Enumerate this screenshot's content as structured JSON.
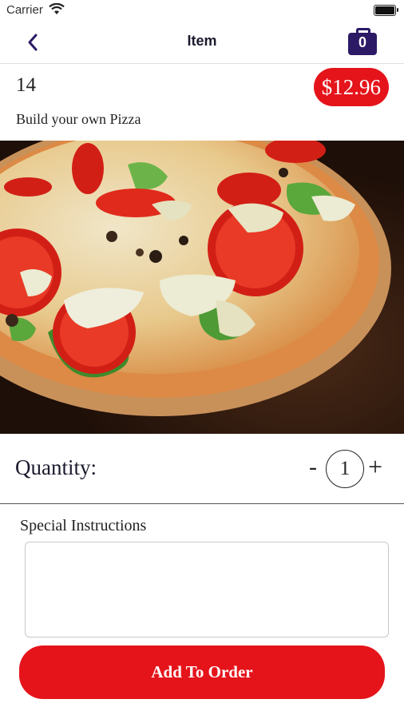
{
  "status_bar": {
    "carrier": "Carrier"
  },
  "nav": {
    "title": "Item",
    "cart_count": "0"
  },
  "item": {
    "number": "14",
    "price": "$12.96",
    "name": "Build your own Pizza"
  },
  "quantity": {
    "label": "Quantity:",
    "minus": "-",
    "value": "1",
    "plus": "+"
  },
  "instructions": {
    "label": "Special Instructions",
    "placeholder": ""
  },
  "add_button": {
    "label": "Add To Order"
  },
  "colors": {
    "accent_red": "#e5141b",
    "brand_purple": "#2c1a66"
  }
}
